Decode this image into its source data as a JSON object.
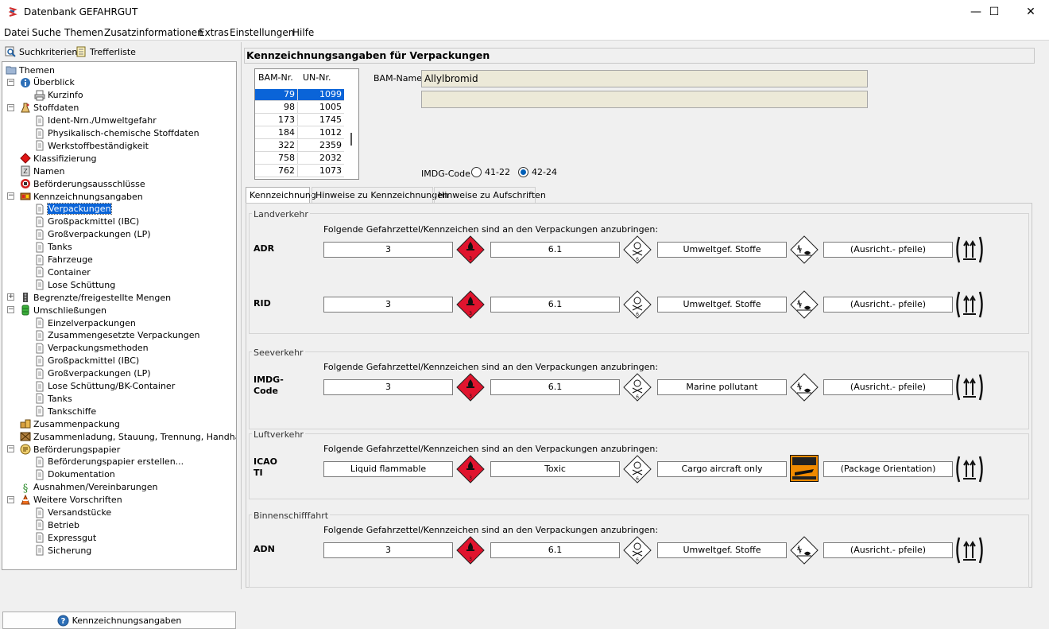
{
  "window": {
    "title": "Datenbank GEFAHRGUT",
    "controls": {
      "minimize": "—",
      "maximize": "☐",
      "close": "✕"
    }
  },
  "menu": [
    "Datei",
    "Suche",
    "Themen",
    "Zusatzinformationen",
    "Extras",
    "Einstellungen",
    "Hilfe"
  ],
  "left": {
    "toolbar": {
      "search": "Suchkriterien",
      "results": "Trefferliste"
    },
    "tree": [
      {
        "label": "Themen",
        "level": 0,
        "icon": "folder-icon"
      },
      {
        "label": "Überblick",
        "level": 1,
        "icon": "info-icon",
        "exp": "-"
      },
      {
        "label": "Kurzinfo",
        "level": 2,
        "icon": "printer-icon"
      },
      {
        "label": "Stoffdaten",
        "level": 1,
        "icon": "flask-icon",
        "exp": "-"
      },
      {
        "label": "Ident-Nrn./Umweltgefahr",
        "level": 2,
        "icon": "document-icon"
      },
      {
        "label": "Physikalisch-chemische Stoffdaten",
        "level": 2,
        "icon": "document-icon"
      },
      {
        "label": "Werkstoffbeständigkeit",
        "level": 2,
        "icon": "document-icon"
      },
      {
        "label": "Klassifizierung",
        "level": 1,
        "icon": "diamond-red-icon"
      },
      {
        "label": "Namen",
        "level": 1,
        "icon": "name-icon"
      },
      {
        "label": "Beförderungsausschlüsse",
        "level": 1,
        "icon": "no-entry-icon"
      },
      {
        "label": "Kennzeichnungsangaben",
        "level": 1,
        "icon": "label-box-icon",
        "exp": "-"
      },
      {
        "label": "Verpackungen",
        "level": 2,
        "icon": "document-icon",
        "selected": true
      },
      {
        "label": "Großpackmittel (IBC)",
        "level": 2,
        "icon": "document-icon"
      },
      {
        "label": "Großverpackungen (LP)",
        "level": 2,
        "icon": "document-icon"
      },
      {
        "label": "Tanks",
        "level": 2,
        "icon": "document-icon"
      },
      {
        "label": "Fahrzeuge",
        "level": 2,
        "icon": "document-icon"
      },
      {
        "label": "Container",
        "level": 2,
        "icon": "document-icon"
      },
      {
        "label": "Lose Schüttung",
        "level": 2,
        "icon": "document-icon"
      },
      {
        "label": "Begrenzte/freigestellte Mengen",
        "level": 1,
        "icon": "traffic-light-icon",
        "exp": "+"
      },
      {
        "label": "Umschließungen",
        "level": 1,
        "icon": "barrel-icon",
        "exp": "-"
      },
      {
        "label": "Einzelverpackungen",
        "level": 2,
        "icon": "document-icon"
      },
      {
        "label": "Zusammengesetzte Verpackungen",
        "level": 2,
        "icon": "document-icon"
      },
      {
        "label": "Verpackungsmethoden",
        "level": 2,
        "icon": "document-icon"
      },
      {
        "label": "Großpackmittel (IBC)",
        "level": 2,
        "icon": "document-icon"
      },
      {
        "label": "Großverpackungen (LP)",
        "level": 2,
        "icon": "document-icon"
      },
      {
        "label": "Lose Schüttung/BK-Container",
        "level": 2,
        "icon": "document-icon"
      },
      {
        "label": "Tanks",
        "level": 2,
        "icon": "document-icon"
      },
      {
        "label": "Tankschiffe",
        "level": 2,
        "icon": "document-icon"
      },
      {
        "label": "Zusammenpackung",
        "level": 1,
        "icon": "boxes-icon"
      },
      {
        "label": "Zusammenladung, Stauung, Trennung, Handhabung",
        "level": 1,
        "icon": "crate-icon"
      },
      {
        "label": "Beförderungspapier",
        "level": 1,
        "icon": "paper-icon",
        "exp": "-"
      },
      {
        "label": "Beförderungspapier erstellen...",
        "level": 2,
        "icon": "document-icon"
      },
      {
        "label": "Dokumentation",
        "level": 2,
        "icon": "document-icon"
      },
      {
        "label": "Ausnahmen/Vereinbarungen",
        "level": 1,
        "icon": "paragraph-icon"
      },
      {
        "label": "Weitere Vorschriften",
        "level": 1,
        "icon": "cone-icon",
        "exp": "-"
      },
      {
        "label": "Versandstücke",
        "level": 2,
        "icon": "document-icon"
      },
      {
        "label": "Betrieb",
        "level": 2,
        "icon": "document-icon"
      },
      {
        "label": "Expressgut",
        "level": 2,
        "icon": "document-icon"
      },
      {
        "label": "Sicherung",
        "level": 2,
        "icon": "document-icon"
      }
    ],
    "bottom_button": "Kennzeichnungsangaben"
  },
  "main": {
    "title": "Kennzeichnungsangaben für Verpackungen",
    "table": {
      "headers": [
        "BAM-Nr.",
        "UN-Nr."
      ],
      "rows": [
        [
          "79",
          "1099"
        ],
        [
          "98",
          "1005"
        ],
        [
          "173",
          "1745"
        ],
        [
          "184",
          "1012"
        ],
        [
          "322",
          "2359"
        ],
        [
          "758",
          "2032"
        ],
        [
          "762",
          "1073"
        ]
      ],
      "selected": 0
    },
    "bam_name_label": "BAM-Name:",
    "bam_name": "Allylbromid",
    "bam_name2": "",
    "imdg_label": "IMDG-Code",
    "imdg_options": [
      "41-22",
      "42-24"
    ],
    "imdg_selected": 1,
    "tabs": [
      "Kennzeichnung",
      "Hinweise zu Kennzeichnungen",
      "Hinweise zu Aufschriften"
    ],
    "active_tab": 0,
    "instruction": "Folgende Gefahrzettel/Kennzeichen sind an den Verpackungen anzubringen:",
    "groups": [
      {
        "title": "Landverkehr",
        "rows": [
          {
            "label": "ADR",
            "b1": "3",
            "b2": "6.1",
            "b3": "Umweltgef. Stoffe",
            "b4": "(Ausricht.- pfeile)",
            "icon3": "environment-icon"
          },
          {
            "label": "RID",
            "b1": "3",
            "b2": "6.1",
            "b3": "Umweltgef. Stoffe",
            "b4": "(Ausricht.- pfeile)",
            "icon3": "environment-icon"
          }
        ]
      },
      {
        "title": "Seeverkehr",
        "rows": [
          {
            "label": "IMDG-\nCode",
            "b1": "3",
            "b2": "6.1",
            "b3": "Marine pollutant",
            "b4": "(Ausricht.- pfeile)",
            "icon3": "environment-icon"
          }
        ]
      },
      {
        "title": "Luftverkehr",
        "rows": [
          {
            "label": "ICAO\nTI",
            "b1": "Liquid flammable",
            "b2": "Toxic",
            "b3": "Cargo aircraft only",
            "b4": "(Package Orientation)",
            "icon3": "cargo-aircraft-icon"
          }
        ]
      },
      {
        "title": "Binnenschifffahrt",
        "rows": [
          {
            "label": "ADN",
            "b1": "3",
            "b2": "6.1",
            "b3": "Umweltgef. Stoffe",
            "b4": "(Ausricht.- pfeile)",
            "icon3": "environment-icon"
          }
        ]
      }
    ]
  }
}
